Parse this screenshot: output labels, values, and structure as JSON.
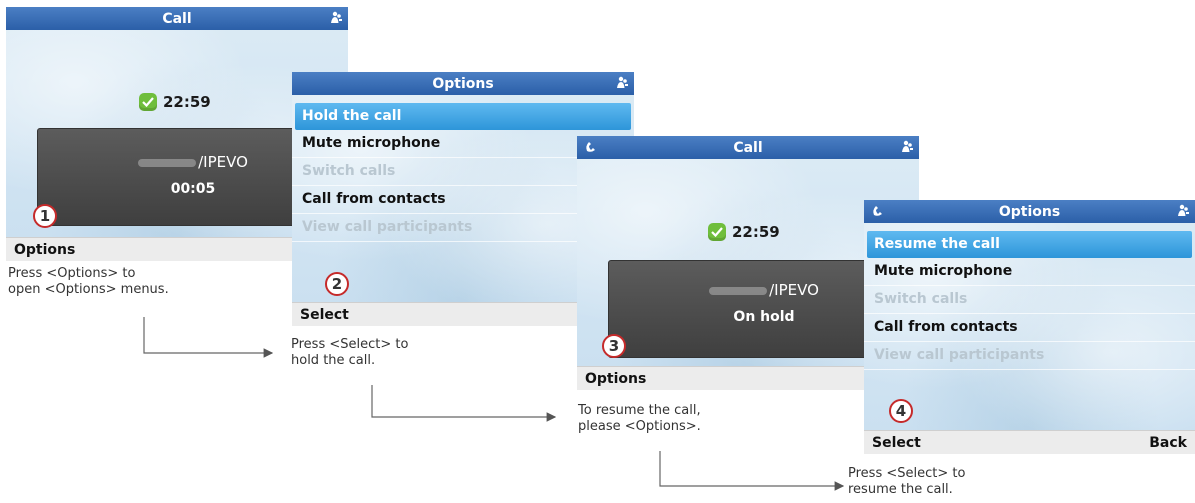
{
  "colors": {
    "titlebar": "#2b5fa8",
    "selection": "#2d95d9",
    "badge_ring": "#c52a2a",
    "check": "#6fbe3c"
  },
  "screen1": {
    "title": "Call",
    "time": "22:59",
    "contact": "/IPEVO",
    "status": "00:05",
    "softkey_left": "Options",
    "step": "1",
    "caption": "Press <Options> to\nopen <Options> menus."
  },
  "screen2": {
    "title": "Options",
    "items": [
      "Hold the call",
      "Mute microphone",
      "Switch calls",
      "Call from contacts",
      "View call participants"
    ],
    "softkey_left": "Select",
    "step": "2",
    "caption": "Press <Select> to\nhold the call."
  },
  "screen3": {
    "title": "Call",
    "time": "22:59",
    "contact": "/IPEVO",
    "status": "On hold",
    "softkey_left": "Options",
    "step": "3",
    "caption": "To resume the call,\nplease <Options>."
  },
  "screen4": {
    "title": "Options",
    "items": [
      "Resume the call",
      "Mute microphone",
      "Switch calls",
      "Call from contacts",
      "View call participants"
    ],
    "softkey_left": "Select",
    "softkey_right": "Back",
    "step": "4",
    "caption": "Press <Select> to\nresume the call."
  },
  "icons": {
    "status": "contacts-status-icon",
    "hold": "handset-hold-icon",
    "check": "check-icon"
  }
}
